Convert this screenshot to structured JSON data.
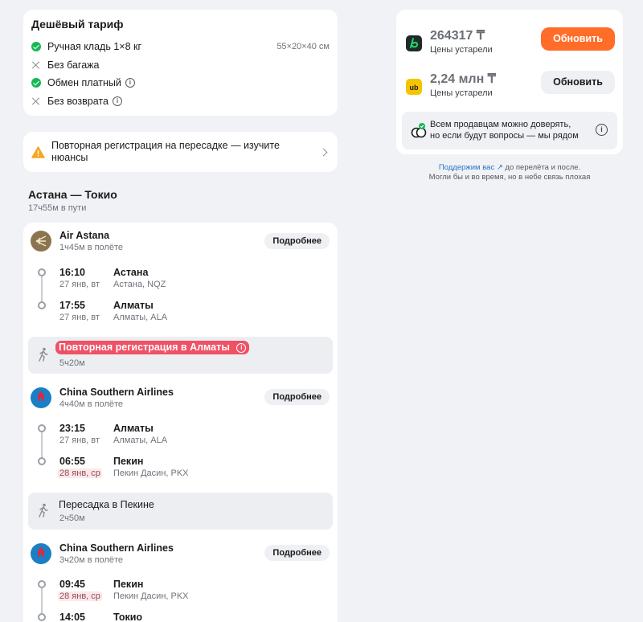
{
  "tariff": {
    "title": "Дешёвый тариф",
    "rows": [
      {
        "label": "Ручная кладь 1×8 кг",
        "right": "55×20×40 см"
      },
      {
        "label": "Без багажа"
      },
      {
        "label": "Обмен платный"
      },
      {
        "label": "Без возврата"
      }
    ]
  },
  "notice": {
    "text": "Повторная регистрация на пересадке — изучите нюансы"
  },
  "route": {
    "title": "Астана — Токио",
    "duration": "17ч55м в пути"
  },
  "segments": [
    {
      "airline": "Air Astana",
      "duration": "1ч45м в полёте",
      "more": "Подробнее",
      "dep": {
        "time": "16:10",
        "date": "27 янв, вт",
        "city": "Астана",
        "airport": "Астана, NQZ"
      },
      "arr": {
        "time": "17:55",
        "date": "27 янв, вт",
        "city": "Алматы",
        "airport": "Алматы, ALA"
      }
    },
    {
      "airline": "China Southern Airlines",
      "duration": "4ч40м в полёте",
      "more": "Подробнее",
      "dep": {
        "time": "23:15",
        "date": "27 янв, вт",
        "city": "Алматы",
        "airport": "Алматы, ALA"
      },
      "arr": {
        "time": "06:55",
        "date": "28 янв, ср",
        "city": "Пекин",
        "airport": "Пекин Дасин, PKX"
      }
    },
    {
      "airline": "China Southern Airlines",
      "duration": "3ч20м в полёте",
      "more": "Подробнее",
      "dep": {
        "time": "09:45",
        "date": "28 янв, ср",
        "city": "Пекин",
        "airport": "Пекин Дасин, PKX"
      },
      "arr": {
        "time": "14:05",
        "city": "Токио"
      }
    }
  ],
  "transfers": [
    {
      "title": "Повторная регистрация в Алматы",
      "duration": "5ч20м"
    },
    {
      "title": "Пересадка в Пекине",
      "duration": "2ч50м"
    }
  ],
  "sellers": [
    {
      "price": "264317 ₸",
      "status": "Цены устарели",
      "button": "Обновить",
      "logo_color": "#1f2a2a"
    },
    {
      "price": "2,24 млн ₸",
      "status": "Цены устарели",
      "button": "Обновить",
      "logo_color": "#f5c400"
    }
  ],
  "trust": {
    "line1": "Всем продавцам можно доверять,",
    "line2": "но если будут вопросы — мы рядом"
  },
  "support": {
    "link": "Поддержим вас ↗",
    "line1_rest": " до перелёта и после.",
    "line2": "Могли бы и во время, но в небе связь плохая"
  },
  "colors": {
    "accent": "#ff6d29",
    "warning": "#ef5165",
    "ok": "#17b855"
  }
}
